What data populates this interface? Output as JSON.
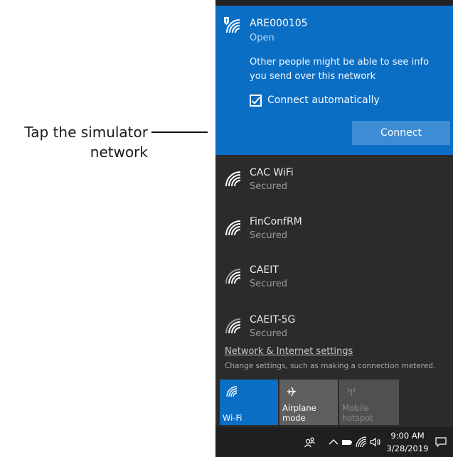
{
  "callout": {
    "line1": "Tap the simulator",
    "line2": "network"
  },
  "selected_network": {
    "name": "ARE000105",
    "status": "Open",
    "warning": "Other people might be able to see info you send over this network",
    "auto_connect_label": "Connect automatically",
    "auto_connect_checked": true,
    "connect_label": "Connect",
    "icon": "wifi-open-icon"
  },
  "networks": [
    {
      "name": "CAC WiFi",
      "status": "Secured",
      "icon": "wifi-icon"
    },
    {
      "name": "FinConfRM",
      "status": "Secured",
      "icon": "wifi-icon"
    },
    {
      "name": "CAEIT",
      "status": "Secured",
      "icon": "wifi-icon"
    },
    {
      "name": "CAEIT-5G",
      "status": "Secured",
      "icon": "wifi-icon"
    }
  ],
  "settings": {
    "link": "Network & Internet settings",
    "subtitle": "Change settings, such as making a connection metered."
  },
  "quick_actions": {
    "wifi": "Wi-Fi",
    "airplane": "Airplane mode",
    "hotspot": "Mobile hotspot"
  },
  "taskbar": {
    "time": "9:00 AM",
    "date": "3/28/2019"
  },
  "colors": {
    "accent": "#0b6ec5",
    "panel": "#2b2b2b",
    "taskbar": "#1f1f1f"
  }
}
